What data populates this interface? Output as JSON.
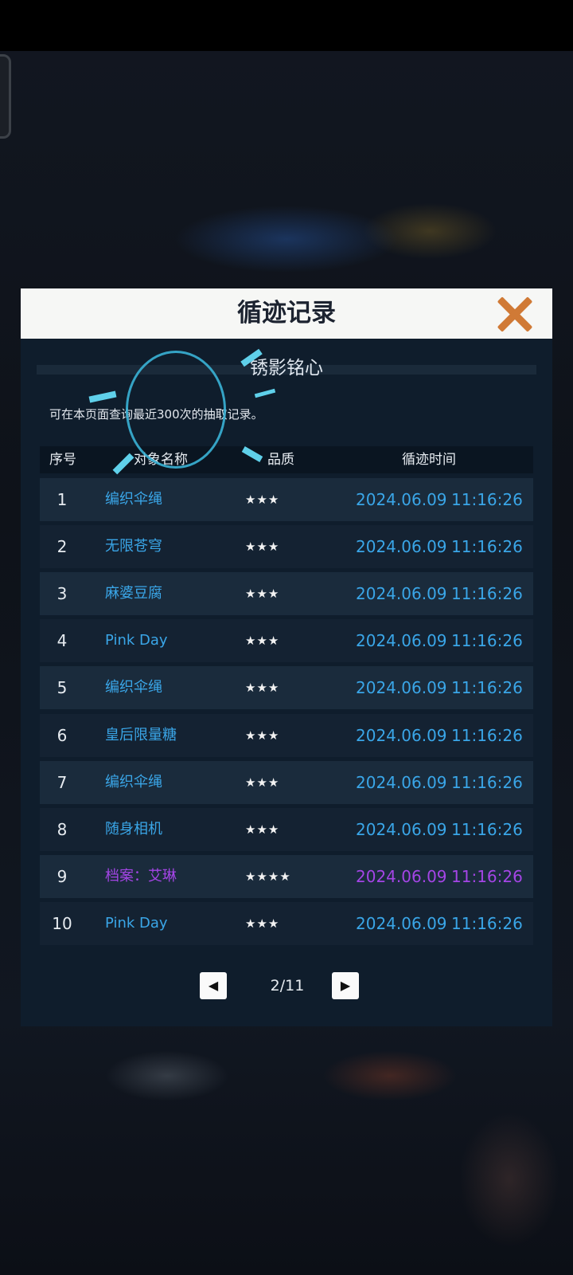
{
  "colors": {
    "accent_blue": "#3aa6e8",
    "accent_purple": "#a445e6",
    "close_orange": "#d07a36",
    "header_bg": "#f6f7f5",
    "dialog_bg": "#0f1d2c"
  },
  "dialog": {
    "title": "循迹记录",
    "close_icon": "close-icon",
    "banner_name": "锈影铭心",
    "notice": "可在本页面查询最近300次的抽取记录。"
  },
  "table": {
    "headers": {
      "index": "序号",
      "name": "对象名称",
      "quality": "品质",
      "time": "循迹时间"
    },
    "rows": [
      {
        "index": "1",
        "name": "编织伞绳",
        "quality": "★★★",
        "date": "2024.06.09",
        "clock": "11:16:26",
        "color": "#3aa6e8"
      },
      {
        "index": "2",
        "name": "无限苍穹",
        "quality": "★★★",
        "date": "2024.06.09",
        "clock": "11:16:26",
        "color": "#3aa6e8"
      },
      {
        "index": "3",
        "name": "麻婆豆腐",
        "quality": "★★★",
        "date": "2024.06.09",
        "clock": "11:16:26",
        "color": "#3aa6e8"
      },
      {
        "index": "4",
        "name": "Pink Day",
        "quality": "★★★",
        "date": "2024.06.09",
        "clock": "11:16:26",
        "color": "#3aa6e8"
      },
      {
        "index": "5",
        "name": "编织伞绳",
        "quality": "★★★",
        "date": "2024.06.09",
        "clock": "11:16:26",
        "color": "#3aa6e8"
      },
      {
        "index": "6",
        "name": "皇后限量糖",
        "quality": "★★★",
        "date": "2024.06.09",
        "clock": "11:16:26",
        "color": "#3aa6e8"
      },
      {
        "index": "7",
        "name": "编织伞绳",
        "quality": "★★★",
        "date": "2024.06.09",
        "clock": "11:16:26",
        "color": "#3aa6e8"
      },
      {
        "index": "8",
        "name": "随身相机",
        "quality": "★★★",
        "date": "2024.06.09",
        "clock": "11:16:26",
        "color": "#3aa6e8"
      },
      {
        "index": "9",
        "name": "档案：艾琳",
        "quality": "★★★★",
        "date": "2024.06.09",
        "clock": "11:16:26",
        "color": "#a445e6"
      },
      {
        "index": "10",
        "name": "Pink Day",
        "quality": "★★★",
        "date": "2024.06.09",
        "clock": "11:16:26",
        "color": "#3aa6e8"
      }
    ]
  },
  "pager": {
    "prev_icon": "triangle-left-icon",
    "next_icon": "triangle-right-icon",
    "page_text": "2/11"
  }
}
